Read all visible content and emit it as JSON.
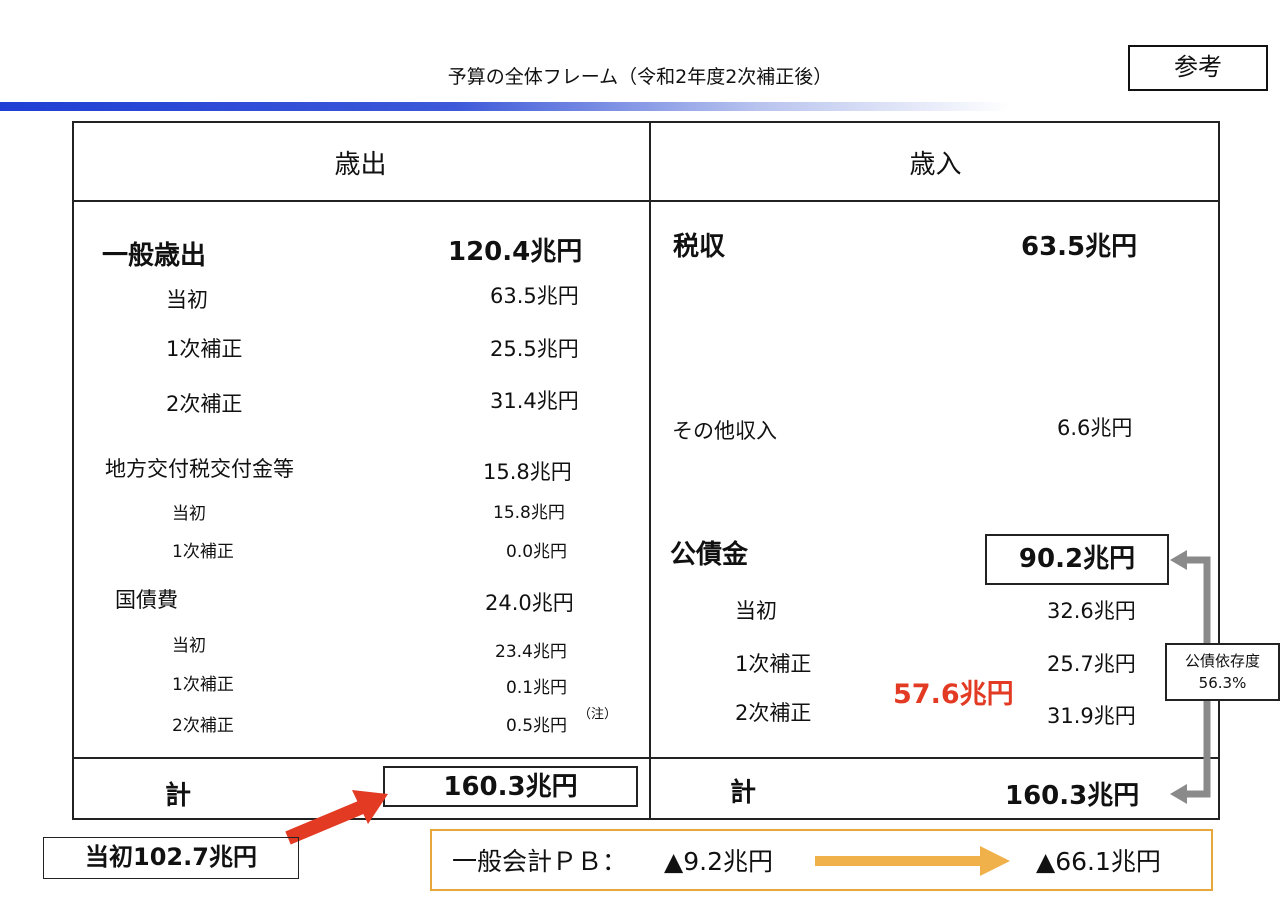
{
  "header": {
    "title": "予算の全体フレーム（令和2年度2次補正後）",
    "ref_label": "参考"
  },
  "table": {
    "left_header": "歳出",
    "right_header": "歳入",
    "expenditure": {
      "general": {
        "label": "一般歳出",
        "value": "120.4兆円"
      },
      "general_items": [
        {
          "label": "当初",
          "value": "63.5兆円"
        },
        {
          "label": "1次補正",
          "value": "25.5兆円"
        },
        {
          "label": "2次補正",
          "value": "31.4兆円"
        }
      ],
      "local": {
        "label": "地方交付税交付金等",
        "value": "15.8兆円"
      },
      "local_items": [
        {
          "label": "当初",
          "value": "15.8兆円"
        },
        {
          "label": "1次補正",
          "value": "0.0兆円"
        }
      ],
      "debt": {
        "label": "国債費",
        "value": "24.0兆円"
      },
      "debt_items": [
        {
          "label": "当初",
          "value": "23.4兆円"
        },
        {
          "label": "1次補正",
          "value": "0.1兆円"
        },
        {
          "label": "2次補正",
          "value": "0.5兆円"
        }
      ],
      "note_mark": "（注）",
      "total_label": "計",
      "total_value": "160.3兆円"
    },
    "revenue": {
      "tax": {
        "label": "税収",
        "value": "63.5兆円"
      },
      "other": {
        "label": "その他収入",
        "value": "6.6兆円"
      },
      "bonds": {
        "label": "公債金",
        "value": "90.2兆円"
      },
      "bond_items": [
        {
          "label": "当初",
          "value": "32.6兆円"
        },
        {
          "label": "1次補正",
          "value": "25.7兆円"
        },
        {
          "label": "2次補正",
          "value": "31.9兆円"
        }
      ],
      "supplementary_sum": "57.6兆円",
      "total_label": "計",
      "total_value": "160.3兆円"
    }
  },
  "initial_callout": "当初102.7兆円",
  "dependency": {
    "label": "公債依存度",
    "value": "56.3%"
  },
  "pb": {
    "label": "一般会計ＰＢ：",
    "from": "▲9.2兆円",
    "to": "▲66.1兆円"
  },
  "colors": {
    "accent_blue": "#1f3fd4",
    "red": "#e23a23",
    "orange": "#e8a73a",
    "gray_arrow": "#8a8a8a"
  }
}
